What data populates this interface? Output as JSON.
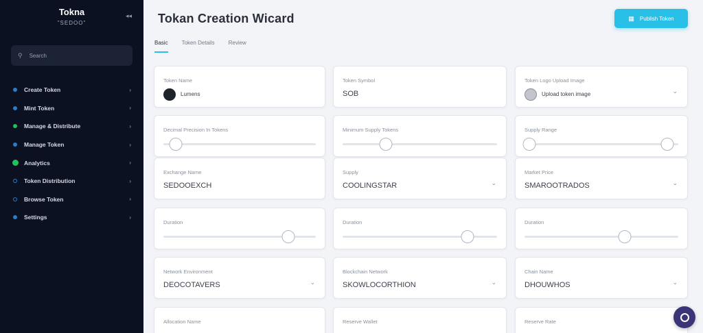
{
  "sidebar": {
    "brand_title": "Tokna",
    "brand_subtitle": "\"SEDOO\"",
    "collapse_icon": "chevrons-left-icon",
    "search_placeholder": "Search",
    "items": [
      {
        "label": "Create Token"
      },
      {
        "label": "Mint Token"
      },
      {
        "label": "Manage & Distribute"
      },
      {
        "label": "Manage Token"
      },
      {
        "label": "Analytics",
        "active": true
      },
      {
        "label": "Token Distribution"
      },
      {
        "label": "Browse Token"
      },
      {
        "label": "Settings"
      }
    ]
  },
  "header": {
    "title": "Tokan Creation Wicard",
    "primary_button": "Publish Token",
    "tabs": [
      "Basic",
      "Token Details",
      "Review"
    ]
  },
  "fields": {
    "r1c1": {
      "label": "Token Name",
      "value": "Lumens"
    },
    "r1c2": {
      "label": "Token Symbol",
      "value": "SOB"
    },
    "r1c3": {
      "label": "Token Logo Upload Image",
      "value": "Upload token image"
    },
    "r2c1": {
      "label": "Decimal Precision In Tokens",
      "slider": 0.08
    },
    "r2c2": {
      "label": "Minimum Supply Tokens",
      "slider": 0.28
    },
    "r2c3": {
      "label": "Supply Range",
      "slider_low": 0.03,
      "slider_high": 0.93
    },
    "r3c1": {
      "label": "Exchange Name",
      "value": "SEDOOEXCH"
    },
    "r3c2": {
      "label": "Supply",
      "value": "COOLINGSTAR"
    },
    "r3c3": {
      "label": "Market Price",
      "value": "SMAROOTRADOS"
    },
    "r4c1": {
      "label": "Duration",
      "slider": 0.82
    },
    "r4c2": {
      "label": "Duration",
      "slider": 0.81
    },
    "r4c3": {
      "label": "Duration",
      "slider": 0.65
    },
    "r5c1": {
      "label": "Network Environment",
      "value": "DEOCOTAVERS"
    },
    "r5c2": {
      "label": "Blockchain Network",
      "value": "SKOWLOCORTHION"
    },
    "r5c3": {
      "label": "Chain Name",
      "value": "DHOUWHOS"
    },
    "r6c1": {
      "label": "Allocation Name"
    },
    "r6c2": {
      "label": "Reserve Wallet"
    },
    "r6c3": {
      "label": "Reserve Rate"
    }
  },
  "colors": {
    "accent": "#29c0e8",
    "sidebar": "#0b1121",
    "active": "#20c35a"
  }
}
